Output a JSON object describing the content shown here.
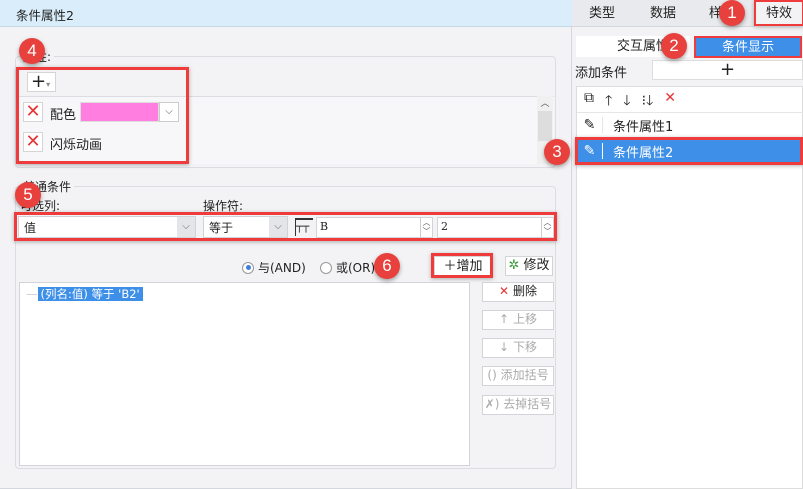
{
  "dialog": {
    "title": "条件属性2"
  },
  "attributes": {
    "group_label": "属性:",
    "add_icon": "plus-dropdown-icon",
    "items": [
      {
        "label": "配色",
        "color": "#ff7ee0"
      },
      {
        "label": "闪烁动画"
      }
    ]
  },
  "condition": {
    "group_label": "普通条件",
    "column_label": "可选列:",
    "operator_label": "操作符:",
    "column_value": "值",
    "operator_value": "等于",
    "cell_col": "B",
    "cell_row": "2",
    "and_label": "与(AND)",
    "or_label": "或(OR)",
    "and_checked": true,
    "add_label": "增加",
    "modify_label": "修改",
    "list": [
      "(列名:值) 等于 'B2'"
    ],
    "side_buttons": {
      "delete": "删除",
      "up": "上移",
      "down": "下移",
      "add_bracket": "添加括号",
      "remove_bracket": "去掉括号"
    }
  },
  "right": {
    "tabs": [
      "类型",
      "数据",
      "样式",
      "特效"
    ],
    "active_tab": "特效",
    "subtabs": [
      "交互属性",
      "条件显示"
    ],
    "add_condition_label": "添加条件",
    "add_symbol": "+",
    "conditions": [
      "条件属性1",
      "条件属性2"
    ]
  },
  "badges": [
    "1",
    "2",
    "3",
    "4",
    "5",
    "6"
  ],
  "colors": {
    "accent": "#3d8fe8",
    "annotation": "#ee3b3b"
  }
}
